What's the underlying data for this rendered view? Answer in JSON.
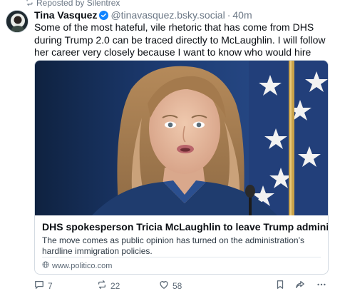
{
  "repost": {
    "label": "Reposted by Silentrex"
  },
  "post": {
    "author_name": "Tina Vasquez",
    "handle": "@tinavasquez.bsky.social",
    "separator": "·",
    "time": "40m",
    "text": "Some of the most hateful, vile rhetoric that has come from DHS during Trump 2.0 can be traced directly to McLaughlin. I will follow her career very closely because I want to know who would hire such a monster."
  },
  "link_card": {
    "title": "DHS spokesperson Tricia McLaughlin to leave Trump administration",
    "description": "The move comes as public opinion has turned on the administration’s hardline immigration policies.",
    "domain": "www.politico.com"
  },
  "actions": {
    "reply_count": "7",
    "repost_count": "22",
    "like_count": "58"
  },
  "colors": {
    "accent": "#1083fe",
    "muted_text": "#6b7785",
    "border": "#d4dbe2"
  },
  "icons": [
    "repost-icon",
    "verified-icon",
    "globe-icon",
    "reply-icon",
    "like-icon",
    "bookmark-icon",
    "share-icon",
    "more-icon"
  ]
}
